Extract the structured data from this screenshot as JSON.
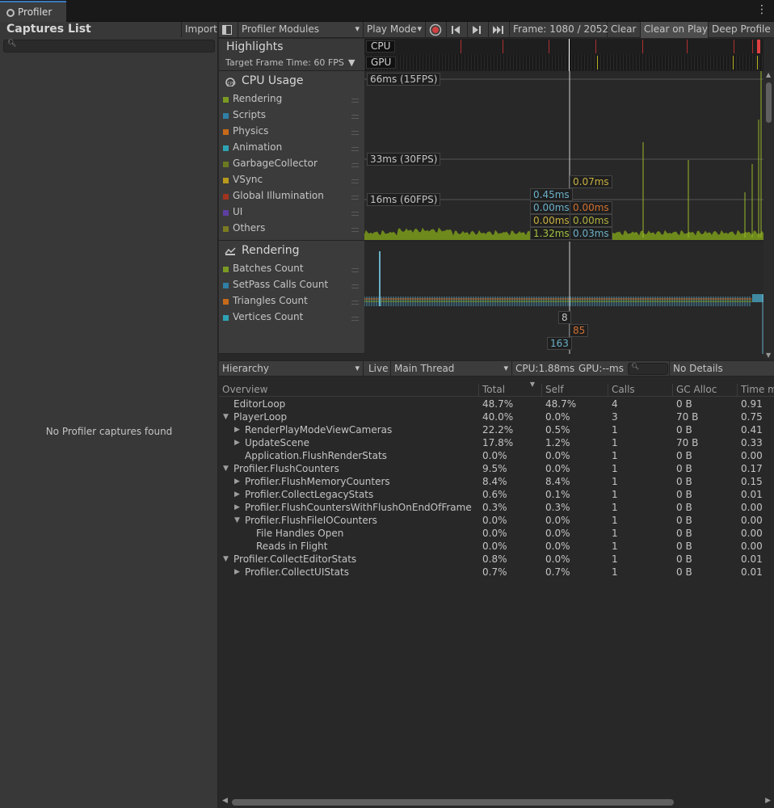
{
  "window": {
    "tab_title": "Profiler",
    "menu_icon": "kebab-menu-icon"
  },
  "captures": {
    "title": "Captures List",
    "import_label": "Import",
    "empty_message": "No Profiler captures found"
  },
  "toolbar": {
    "modules_label": "Profiler Modules",
    "play_mode_label": "Play Mode",
    "frame_label": "Frame: 1080 / 2052",
    "clear_label": "Clear",
    "clear_on_play_label": "Clear on Play",
    "deep_profile_label": "Deep Profile"
  },
  "highlights": {
    "title": "Highlights",
    "target_label": "Target Frame Time: 60 FPS",
    "cpu_label": "CPU",
    "gpu_label": "GPU"
  },
  "cpu_module": {
    "title": "CPU Usage",
    "legend": [
      {
        "label": "Rendering",
        "color": "#7a9a22"
      },
      {
        "label": "Scripts",
        "color": "#2f7fa6"
      },
      {
        "label": "Physics",
        "color": "#c76a1a"
      },
      {
        "label": "Animation",
        "color": "#2ea3b4"
      },
      {
        "label": "GarbageCollector",
        "color": "#6b7a20"
      },
      {
        "label": "VSync",
        "color": "#b89a1c"
      },
      {
        "label": "Global Illumination",
        "color": "#a0341e"
      },
      {
        "label": "UI",
        "color": "#5e3fa0"
      },
      {
        "label": "Others",
        "color": "#7a7a22"
      }
    ],
    "lines": [
      {
        "label": "66ms (15FPS)"
      },
      {
        "label": "33ms (30FPS)"
      },
      {
        "label": "16ms (60FPS)"
      }
    ],
    "tooltip": {
      "top": "0.07ms",
      "left": [
        "0.45ms",
        "0.00ms",
        "0.00ms",
        "1.32ms"
      ],
      "right": [
        "0.00ms",
        "0.00ms",
        "0.03ms"
      ]
    }
  },
  "rendering_module": {
    "title": "Rendering",
    "legend": [
      {
        "label": "Batches Count",
        "color": "#7a9a22"
      },
      {
        "label": "SetPass Calls Count",
        "color": "#2f7fa6"
      },
      {
        "label": "Triangles Count",
        "color": "#c76a1a"
      },
      {
        "label": "Vertices Count",
        "color": "#2ea3b4"
      }
    ],
    "values": {
      "a": "8",
      "b": "85",
      "c": "163"
    }
  },
  "details": {
    "view_label": "Hierarchy",
    "live_label": "Live",
    "thread_label": "Main Thread",
    "cpu_label": "CPU:1.88ms",
    "gpu_label": "GPU:--ms",
    "no_details_label": "No Details"
  },
  "table": {
    "headers": [
      "Overview",
      "Total",
      "Self",
      "Calls",
      "GC Alloc",
      "Time m"
    ],
    "rows": [
      {
        "name": "EditorLoop",
        "total": "48.7%",
        "self": "48.7%",
        "calls": "4",
        "gc": "0 B",
        "time": "0.91"
      },
      {
        "name": "PlayerLoop",
        "total": "40.0%",
        "self": "0.0%",
        "calls": "3",
        "gc": "70 B",
        "time": "0.75"
      },
      {
        "name": "RenderPlayModeViewCameras",
        "total": "22.2%",
        "self": "0.5%",
        "calls": "1",
        "gc": "0 B",
        "time": "0.41"
      },
      {
        "name": "UpdateScene",
        "total": "17.8%",
        "self": "1.2%",
        "calls": "1",
        "gc": "70 B",
        "time": "0.33"
      },
      {
        "name": "Application.FlushRenderStats",
        "total": "0.0%",
        "self": "0.0%",
        "calls": "1",
        "gc": "0 B",
        "time": "0.00"
      },
      {
        "name": "Profiler.FlushCounters",
        "total": "9.5%",
        "self": "0.0%",
        "calls": "1",
        "gc": "0 B",
        "time": "0.17"
      },
      {
        "name": "Profiler.FlushMemoryCounters",
        "total": "8.4%",
        "self": "8.4%",
        "calls": "1",
        "gc": "0 B",
        "time": "0.15"
      },
      {
        "name": "Profiler.CollectLegacyStats",
        "total": "0.6%",
        "self": "0.1%",
        "calls": "1",
        "gc": "0 B",
        "time": "0.01"
      },
      {
        "name": "Profiler.FlushCountersWithFlushOnEndOfFrame",
        "total": "0.3%",
        "self": "0.3%",
        "calls": "1",
        "gc": "0 B",
        "time": "0.00"
      },
      {
        "name": "Profiler.FlushFileIOCounters",
        "total": "0.0%",
        "self": "0.0%",
        "calls": "1",
        "gc": "0 B",
        "time": "0.00"
      },
      {
        "name": "File Handles Open",
        "total": "0.0%",
        "self": "0.0%",
        "calls": "1",
        "gc": "0 B",
        "time": "0.00"
      },
      {
        "name": "Reads in Flight",
        "total": "0.0%",
        "self": "0.0%",
        "calls": "1",
        "gc": "0 B",
        "time": "0.00"
      },
      {
        "name": "Profiler.CollectEditorStats",
        "total": "0.8%",
        "self": "0.0%",
        "calls": "1",
        "gc": "0 B",
        "time": "0.01"
      },
      {
        "name": "Profiler.CollectUIStats",
        "total": "0.7%",
        "self": "0.7%",
        "calls": "1",
        "gc": "0 B",
        "time": "0.01"
      }
    ]
  }
}
